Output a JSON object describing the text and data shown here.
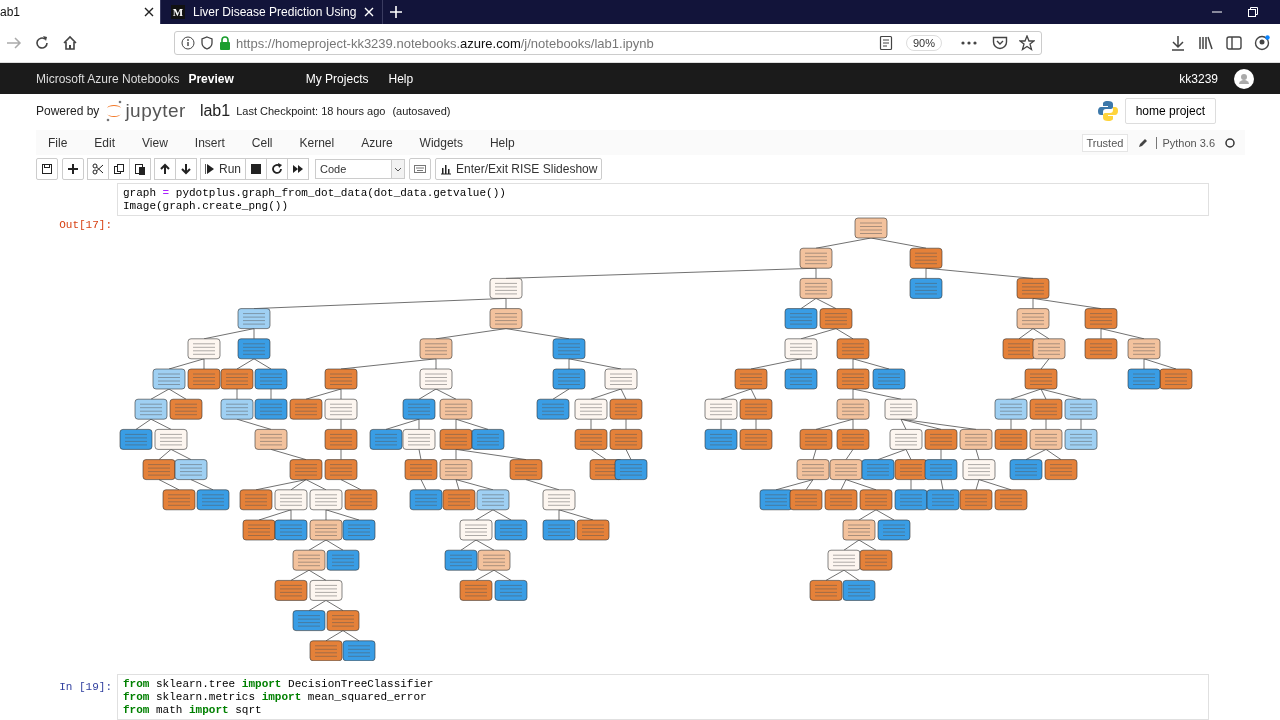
{
  "browser": {
    "tabs": [
      {
        "title": "ab1",
        "selected": true
      },
      {
        "title": "Liver Disease Prediction Using",
        "favicon_text": "M",
        "selected": false
      }
    ],
    "url": {
      "before": "https://homeproject-kk3239.notebooks.",
      "domain": "azure.com",
      "after": "/j/notebooks/lab1.ipynb"
    },
    "zoom": "90%"
  },
  "azure_bar": {
    "brand": "Microsoft Azure Notebooks",
    "badge": "Preview",
    "links": [
      "My Projects",
      "Help"
    ],
    "user": "kk3239"
  },
  "jupyter_header": {
    "powered_by": "Powered by",
    "logo_text": "jupyter",
    "notebook_name": "lab1",
    "checkpoint": "Last Checkpoint: 18 hours ago",
    "autosave": "(autosaved)",
    "project_button": "home project"
  },
  "menu": {
    "items": [
      "File",
      "Edit",
      "View",
      "Insert",
      "Cell",
      "Kernel",
      "Azure",
      "Widgets",
      "Help"
    ],
    "trusted": "Trusted",
    "kernel": "Python 3.6"
  },
  "toolbar": {
    "run": "Run",
    "cell_type": "Code",
    "rise": "Enter/Exit RISE Slideshow"
  },
  "cells": [
    {
      "kind": "code",
      "lines": [
        [
          {
            "t": "graph "
          },
          {
            "t": "=",
            "kind": "operator"
          },
          {
            "t": " pydotplus.graph_from_dot_data(dot_data.getvalue())"
          }
        ],
        [
          {
            "t": "Image(graph.create_png())"
          }
        ]
      ]
    },
    {
      "kind": "output",
      "prompt": "Out[17]:"
    },
    {
      "kind": "code",
      "prompt": "In [19]:",
      "lines": [
        [
          {
            "t": "from",
            "kind": "keyword"
          },
          {
            "t": " sklearn.tree "
          },
          {
            "t": "import",
            "kind": "keyword"
          },
          {
            "t": " DecisionTreeClassifier"
          }
        ],
        [
          {
            "t": "from",
            "kind": "keyword"
          },
          {
            "t": " sklearn.metrics "
          },
          {
            "t": "import",
            "kind": "keyword"
          },
          {
            "t": " mean_squared_error"
          }
        ],
        [
          {
            "t": "from",
            "kind": "keyword"
          },
          {
            "t": " math "
          },
          {
            "t": "import",
            "kind": "keyword"
          },
          {
            "t": " sqrt"
          }
        ]
      ]
    }
  ]
}
